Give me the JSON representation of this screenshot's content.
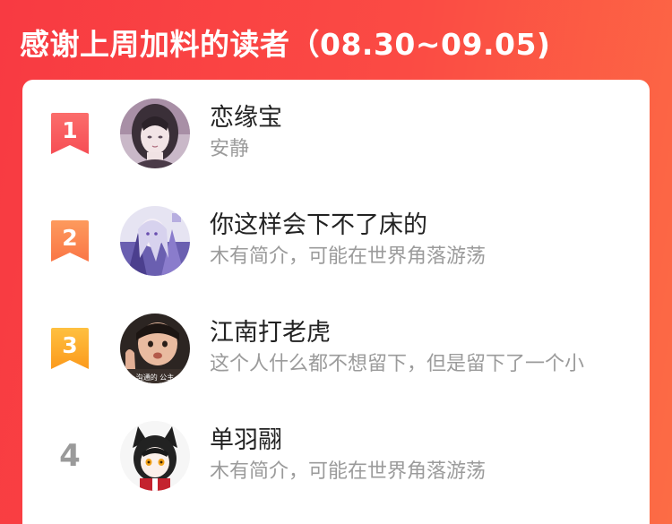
{
  "header": {
    "title": "感谢上周加料的读者（08.30~09.05)"
  },
  "colors": {
    "rank1": "#f9595c",
    "rank2": "#fb844f",
    "rank3": "#fdab2a",
    "rank_plain": "#9a9a9a",
    "name": "#222222",
    "bio": "#9b9b9b"
  },
  "readers": [
    {
      "rank": "1",
      "name": "恋缘宝",
      "bio": "安静",
      "avatar_icon": "anime-girl-sketch-avatar-icon"
    },
    {
      "rank": "2",
      "name": "你这样会下不了床的",
      "bio": "木有简介，可能在世界角落游荡",
      "avatar_icon": "anime-girl-purple-avatar-icon"
    },
    {
      "rank": "3",
      "name": "江南打老虎",
      "bio": "这个人什么都不想留下，但是留下了一个小",
      "avatar_icon": "child-photo-avatar-icon",
      "avatar_caption": "沟通的 公主"
    },
    {
      "rank": "4",
      "name": "单羽翮",
      "bio": "木有简介，可能在世界角落游荡",
      "avatar_icon": "anime-catgirl-avatar-icon"
    }
  ]
}
